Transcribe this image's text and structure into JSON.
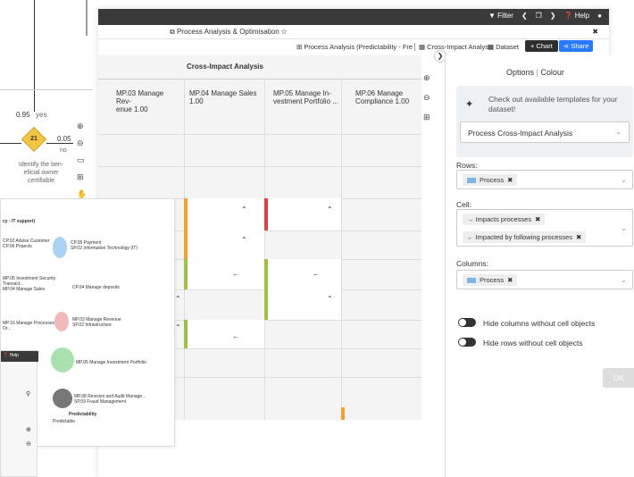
{
  "app": {
    "topbar": {
      "filter": "Filter",
      "help": "Help"
    },
    "subbar": {
      "title": "Process Analysis & Optimisation",
      "star": "☆",
      "close": "✖"
    },
    "toolbar": {
      "breadcrumb": "Process Analysis (Predictability - Fre",
      "tab_cia": "Cross-Impact Analysis",
      "tab_dataset": "Dataset",
      "chart_btn": "+ Chart",
      "share_btn": "Share"
    }
  },
  "grid": {
    "title": "Cross-Impact Analysis",
    "columns": [
      "MP.03 Manage Rev-\nenue 1.00",
      "MP.04 Manage Sales\n1.00",
      "MP.05 Manage In-\nvestment Portfolio ...",
      "MP.06 Manage\nCompliance 1.00"
    ]
  },
  "diagram": {
    "value_a": "0.95",
    "label_a": "yes",
    "node": "21",
    "value_b": "0.05",
    "label_b": "no",
    "caption": "Identify the ben-\neficial owner\ncertifiable"
  },
  "overlay": {
    "title": "cy - IT support)",
    "items": [
      "CP.05 Payment\nSP.02 Information Technology (IT)",
      "CP.04 Manage deposits",
      "MP.03 Manage Revenue\nSP.02 Infrastructure",
      "MP.05 Manage Investment Portfolio",
      "MP.08 Revision and Audit Manage...\nSP.09 Fraud Management"
    ],
    "left_items": [
      "CP.02 Advise Customer\nCP.06 Projects",
      "MP.05 Investment Security Transact...\nMP.04 Manage Sales",
      "MP.16 Manage Processes and Or..."
    ],
    "legend": "Predictability",
    "legend_small": "Predictable",
    "mini_help": "Help"
  },
  "panel": {
    "tab_options": "Options",
    "tab_colour": "Colour",
    "templates_hint": "Check out available templates for your dataset!",
    "template_select": "Process Cross-Impact Analysis",
    "rows_label": "Rows:",
    "rows_chip": "Process",
    "cell_label": "Cell:",
    "cell_chip1": "→ Impacts processes",
    "cell_chip2": "← Impacted by following processes",
    "columns_label": "Columns:",
    "columns_chip": "Process",
    "hide_cols": "Hide columns without cell objects",
    "hide_rows": "Hide rows without cell objects",
    "ok": "OK"
  },
  "colors": {
    "orange": "#f0a030",
    "red": "#e04040",
    "lime": "#a0c040",
    "accent": "#2979ff",
    "node": "#f5c542"
  }
}
